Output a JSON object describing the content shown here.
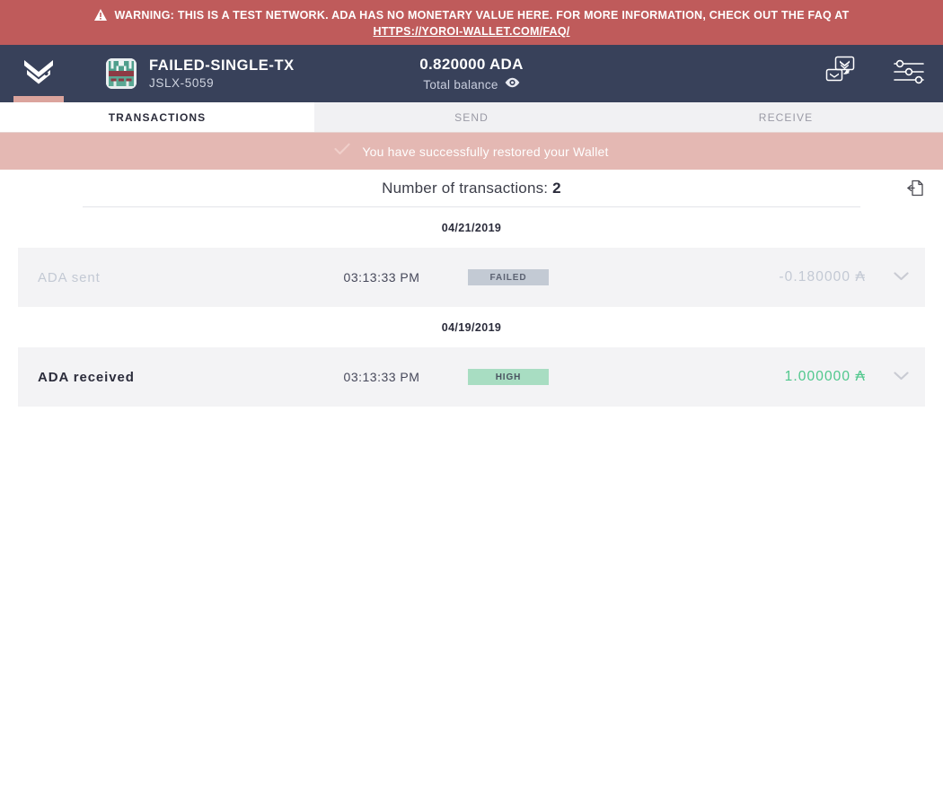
{
  "warning": {
    "icon": "warning-triangle-icon",
    "text": "WARNING: THIS IS A TEST NETWORK. ADA HAS NO MONETARY VALUE HERE. FOR MORE INFORMATION, CHECK OUT THE FAQ AT",
    "link_text": "HTTPS://YOROI-WALLET.COM/FAQ/",
    "bg_color": "#bf5b5b"
  },
  "topbar": {
    "logo_icon": "yoroi-logo-icon",
    "wallet_name": "FAILED-SINGLE-TX",
    "wallet_plate": "JSLX-5059",
    "avatar_icon": "wallet-identicon-avatar",
    "balance_amount": "0.820000 ADA",
    "balance_label": "Total balance",
    "balance_eye_icon": "eye-icon",
    "actions": [
      {
        "icon": "wallet-switch-icon",
        "name": "switch-wallet-button"
      },
      {
        "icon": "settings-sliders-icon",
        "name": "settings-button"
      }
    ],
    "bg_color": "#38415a",
    "active_underline_color": "#dba49d"
  },
  "tabs": [
    {
      "label": "TRANSACTIONS",
      "active": true
    },
    {
      "label": "SEND",
      "active": false
    },
    {
      "label": "RECEIVE",
      "active": false
    }
  ],
  "notification": {
    "icon": "check-icon",
    "text": "You have successfully restored your Wallet",
    "bg_color": "#e4b8b3"
  },
  "summary": {
    "label": "Number of transactions:",
    "count": "2",
    "export_icon": "export-document-icon"
  },
  "transaction_groups": [
    {
      "date": "04/21/2019",
      "transactions": [
        {
          "type": "ADA sent",
          "time": "03:13:33 PM",
          "status": "FAILED",
          "status_kind": "failed",
          "amount": "-0.180000",
          "currency_symbol": "₳",
          "pending": true,
          "expand_icon": "chevron-down-icon"
        }
      ]
    },
    {
      "date": "04/19/2019",
      "transactions": [
        {
          "type": "ADA received",
          "time": "03:13:33 PM",
          "status": "HIGH",
          "status_kind": "high",
          "amount": "1.000000",
          "currency_symbol": "₳",
          "pending": false,
          "expand_icon": "chevron-down-icon"
        }
      ]
    }
  ],
  "colors": {
    "accent_pink": "#dba49d",
    "green": "#4fc78c",
    "muted": "#c3c9d4",
    "dark": "#2b2c3b"
  }
}
